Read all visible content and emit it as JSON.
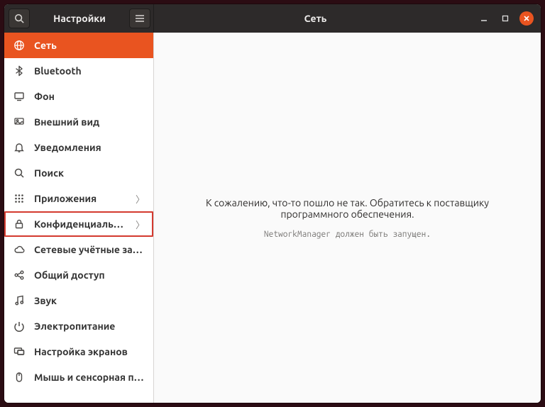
{
  "header": {
    "left_title": "Настройки",
    "right_title": "Сеть"
  },
  "sidebar": {
    "items": [
      {
        "id": "network",
        "label": "Сеть",
        "has_sub": false,
        "active": true,
        "highlight": false
      },
      {
        "id": "bluetooth",
        "label": "Bluetooth",
        "has_sub": false,
        "active": false,
        "highlight": false
      },
      {
        "id": "background",
        "label": "Фон",
        "has_sub": false,
        "active": false,
        "highlight": false
      },
      {
        "id": "appearance",
        "label": "Внешний вид",
        "has_sub": false,
        "active": false,
        "highlight": false
      },
      {
        "id": "notifications",
        "label": "Уведомления",
        "has_sub": false,
        "active": false,
        "highlight": false
      },
      {
        "id": "search",
        "label": "Поиск",
        "has_sub": false,
        "active": false,
        "highlight": false
      },
      {
        "id": "applications",
        "label": "Приложения",
        "has_sub": true,
        "active": false,
        "highlight": false
      },
      {
        "id": "privacy",
        "label": "Конфиденциальность",
        "has_sub": true,
        "active": false,
        "highlight": true
      },
      {
        "id": "online",
        "label": "Сетевые учётные записи",
        "has_sub": false,
        "active": false,
        "highlight": false
      },
      {
        "id": "sharing",
        "label": "Общий доступ",
        "has_sub": false,
        "active": false,
        "highlight": false
      },
      {
        "id": "sound",
        "label": "Звук",
        "has_sub": false,
        "active": false,
        "highlight": false
      },
      {
        "id": "power",
        "label": "Электропитание",
        "has_sub": false,
        "active": false,
        "highlight": false
      },
      {
        "id": "displays",
        "label": "Настройка экранов",
        "has_sub": false,
        "active": false,
        "highlight": false
      },
      {
        "id": "mouse",
        "label": "Мышь и сенсорная панель",
        "has_sub": false,
        "active": false,
        "highlight": false
      }
    ]
  },
  "content": {
    "error_main": "К сожалению, что-то пошло не так. Обратитесь к поставщику программного обеспечения.",
    "error_sub": "NetworkManager должен быть запущен."
  },
  "colors": {
    "accent": "#e95420",
    "highlight_ring": "#d43a2f",
    "headerbar": "#2d2a2a"
  },
  "icons": {
    "network": "globe-icon",
    "bluetooth": "bluetooth-icon",
    "background": "display-icon",
    "appearance": "appearance-icon",
    "notifications": "bell-icon",
    "search": "search-icon",
    "applications": "grid-icon",
    "privacy": "lock-icon",
    "online": "cloud-icon",
    "sharing": "share-icon",
    "sound": "music-icon",
    "power": "power-icon",
    "displays": "monitor-icon",
    "mouse": "mouse-icon"
  }
}
